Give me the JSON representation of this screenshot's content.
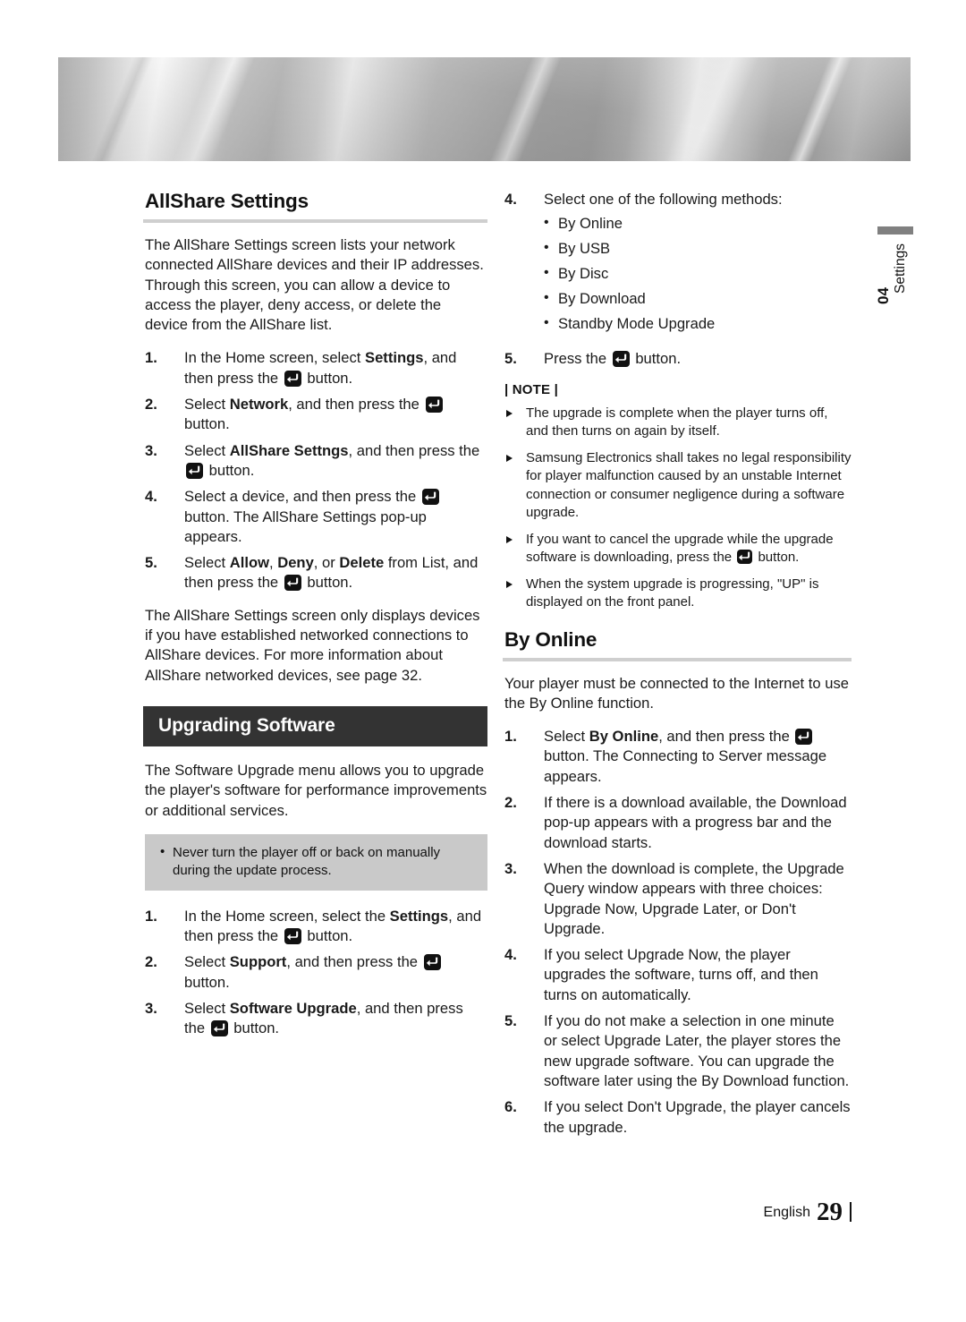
{
  "page": {
    "chapter_number": "04",
    "chapter_label": "Settings",
    "footer_language": "English",
    "footer_page_number": "29",
    "banner_accent_color": "#808080",
    "section_banner_color": "#333333",
    "caution_box_color": "#c9c9c9",
    "rule_color": "#cfcfcf"
  },
  "icons": {
    "enter_button": "enter-button-icon"
  },
  "left_column": {
    "heading": "AllShare Settings",
    "intro": "The AllShare Settings screen lists your network connected AllShare devices and their IP addresses. Through this screen, you can allow a device to access the player, deny access, or delete the device from the AllShare list.",
    "steps": [
      {
        "num": "1.",
        "parts": [
          {
            "t": "In the Home screen, select ",
            "b": false
          },
          {
            "t": "Settings",
            "b": true
          },
          {
            "t": ", and then press the ",
            "b": false
          },
          {
            "t": "ICON",
            "b": false
          },
          {
            "t": " button.",
            "b": false
          }
        ]
      },
      {
        "num": "2.",
        "parts": [
          {
            "t": "Select ",
            "b": false
          },
          {
            "t": "Network",
            "b": true
          },
          {
            "t": ", and then press the ",
            "b": false
          },
          {
            "t": "ICON",
            "b": false
          },
          {
            "t": " button.",
            "b": false
          }
        ]
      },
      {
        "num": "3.",
        "parts": [
          {
            "t": "Select ",
            "b": false
          },
          {
            "t": "AllShare Settngs",
            "b": true
          },
          {
            "t": ", and then press the ",
            "b": false
          },
          {
            "t": "ICON",
            "b": false
          },
          {
            "t": " button.",
            "b": false
          }
        ]
      },
      {
        "num": "4.",
        "parts": [
          {
            "t": "Select a device, and then press the ",
            "b": false
          },
          {
            "t": "ICON",
            "b": false
          },
          {
            "t": " button. The AllShare Settings pop-up appears.",
            "b": false
          }
        ]
      },
      {
        "num": "5.",
        "parts": [
          {
            "t": "Select ",
            "b": false
          },
          {
            "t": "Allow",
            "b": true
          },
          {
            "t": ", ",
            "b": false
          },
          {
            "t": "Deny",
            "b": true
          },
          {
            "t": ", or ",
            "b": false
          },
          {
            "t": "Delete",
            "b": true
          },
          {
            "t": " from List, and then press the ",
            "b": false
          },
          {
            "t": "ICON",
            "b": false
          },
          {
            "t": " button.",
            "b": false
          }
        ]
      }
    ],
    "outro": "The AllShare Settings screen only displays devices if you have established networked connections to AllShare devices. For more information about AllShare networked devices, see page 32.",
    "banner_heading": "Upgrading Software",
    "upgrade_intro": "The Software Upgrade menu allows you to upgrade the player's software for performance improvements or additional services.",
    "caution_items": [
      "Never turn the player off or back on manually during the update process."
    ],
    "upgrade_steps": [
      {
        "num": "1.",
        "parts": [
          {
            "t": "In the Home screen, select the ",
            "b": false
          },
          {
            "t": "Settings",
            "b": true
          },
          {
            "t": ", and then press the ",
            "b": false
          },
          {
            "t": "ICON",
            "b": false
          },
          {
            "t": " button.",
            "b": false
          }
        ]
      },
      {
        "num": "2.",
        "parts": [
          {
            "t": "Select ",
            "b": false
          },
          {
            "t": "Support",
            "b": true
          },
          {
            "t": ", and then press the ",
            "b": false
          },
          {
            "t": "ICON",
            "b": false
          },
          {
            "t": " button.",
            "b": false
          }
        ]
      },
      {
        "num": "3.",
        "parts": [
          {
            "t": "Select ",
            "b": false
          },
          {
            "t": "Software Upgrade",
            "b": true
          },
          {
            "t": ", and then press the ",
            "b": false
          },
          {
            "t": "ICON",
            "b": false
          },
          {
            "t": " button.",
            "b": false
          }
        ]
      }
    ]
  },
  "right_column": {
    "step4": {
      "num": "4.",
      "text": "Select one of the following methods:",
      "bullets": [
        "By Online",
        "By USB",
        "By Disc",
        "By Download",
        "Standby Mode Upgrade"
      ]
    },
    "step5": {
      "num": "5.",
      "parts": [
        {
          "t": "Press the ",
          "b": false
        },
        {
          "t": "ICON",
          "b": false
        },
        {
          "t": " button.",
          "b": false
        }
      ]
    },
    "note_title": "| NOTE |",
    "notes": [
      [
        {
          "t": "The upgrade is complete when the player turns off, and then turns on again by itself.",
          "b": false
        }
      ],
      [
        {
          "t": "Samsung Electronics shall takes no legal responsibility for player malfunction caused by an unstable Internet connection or consumer negligence during a software upgrade.",
          "b": false
        }
      ],
      [
        {
          "t": "If you want to cancel the upgrade while the upgrade software is downloading, press the ",
          "b": false
        },
        {
          "t": "ICON",
          "b": false
        },
        {
          "t": " button.",
          "b": false
        }
      ],
      [
        {
          "t": "When the system upgrade is progressing, \"UP\" is displayed on the front panel.",
          "b": false
        }
      ]
    ],
    "heading": "By Online",
    "intro": "Your player must be connected to the Internet to use the By Online function.",
    "steps": [
      {
        "num": "1.",
        "parts": [
          {
            "t": "Select ",
            "b": false
          },
          {
            "t": "By Online",
            "b": true
          },
          {
            "t": ", and then press the ",
            "b": false
          },
          {
            "t": "ICON",
            "b": false
          },
          {
            "t": " button. The Connecting to Server message appears.",
            "b": false
          }
        ]
      },
      {
        "num": "2.",
        "parts": [
          {
            "t": "If there is a download available, the Download pop-up appears with a progress bar and the download starts.",
            "b": false
          }
        ]
      },
      {
        "num": "3.",
        "parts": [
          {
            "t": "When the download is complete, the Upgrade Query window appears with three choices: Upgrade Now, Upgrade Later, or Don't Upgrade.",
            "b": false
          }
        ]
      },
      {
        "num": "4.",
        "parts": [
          {
            "t": "If you select Upgrade Now, the player upgrades the software, turns off, and then turns on automatically.",
            "b": false
          }
        ]
      },
      {
        "num": "5.",
        "parts": [
          {
            "t": "If you do not make a selection in one minute or select Upgrade Later, the player stores the new upgrade software. You can upgrade the software later using the By Download function.",
            "b": false
          }
        ]
      },
      {
        "num": "6.",
        "parts": [
          {
            "t": "If you select Don't Upgrade, the player cancels the upgrade.",
            "b": false
          }
        ]
      }
    ]
  }
}
